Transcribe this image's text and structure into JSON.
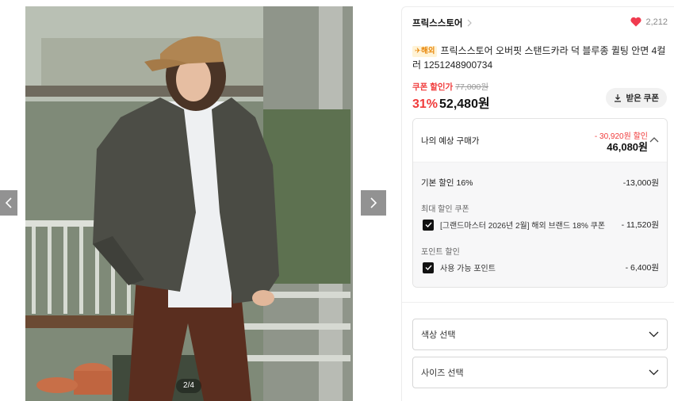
{
  "gallery": {
    "counter": "2/4",
    "prev_icon": "chevron-left-icon",
    "next_icon": "chevron-right-icon"
  },
  "store": {
    "name": "프릭스스토어",
    "like_count": "2,212",
    "heart_color": "#f03b4f"
  },
  "product": {
    "badge": "해외",
    "title": "프릭스스토어 오버핏 스탠드카라 덕 블루종 퀼팅 안면 4컬러 1251248900734"
  },
  "price": {
    "coupon_label": "쿠폰 할인가",
    "original": "77,000원",
    "discount_rate": "31%",
    "final": "52,480원",
    "coupon_button": "받은 쿠폰"
  },
  "estimate": {
    "label": "나의 예상 구매가",
    "total_discount": "- 30,920원 할인",
    "price": "46,080원",
    "base_discount_label": "기본 할인 16%",
    "base_discount_amount": "-13,000원",
    "coupon_section": "최대 할인 쿠폰",
    "coupon_name": "[그랜드마스터 2026년 2월] 해외 브랜드 18% 쿠폰",
    "coupon_amount": "- 11,520원",
    "point_section": "포인트 할인",
    "point_name": "사용 가능 포인트",
    "point_amount": "- 6,400원"
  },
  "options": {
    "color_select": "색상 선택",
    "size_select": "사이즈 선택"
  },
  "colors": {
    "accent_red": "#f03b3b",
    "badge_orange": "#e8870b"
  }
}
